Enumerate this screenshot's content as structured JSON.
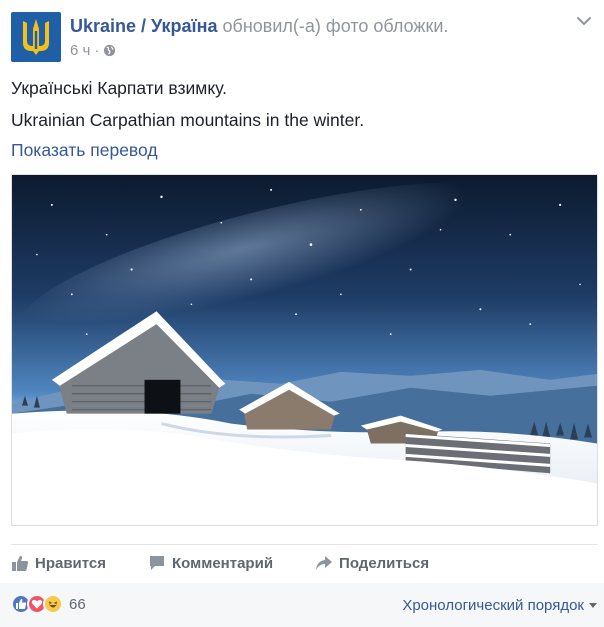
{
  "post": {
    "page_name": "Ukraine / Україна",
    "action_text": "обновил(-а) фото обложки.",
    "time": "6 ч",
    "separator": "·",
    "text_uk": "Українські Карпати взимку.",
    "text_en": "Ukrainian Carpathian mountains in the winter.",
    "translate_link": "Показать перевод"
  },
  "actions": {
    "like_label": "Нравится",
    "comment_label": "Комментарий",
    "share_label": "Поделиться"
  },
  "reactions": {
    "count": "66",
    "sort_label": "Хронологический порядок",
    "types": [
      "like",
      "love",
      "haha"
    ]
  },
  "colors": {
    "link": "#365899",
    "avatar_bg": "#1f5fa8",
    "trident": "#f2c11c",
    "like": "#4f77c6",
    "love": "#f25268",
    "haha": "#f7c94b"
  },
  "icons": {
    "avatar": "trident-coat-of-arms-icon",
    "privacy": "globe-icon",
    "menu": "chevron-down-icon",
    "like": "thumbs-up-icon",
    "comment": "speech-bubble-icon",
    "share": "share-arrow-icon"
  }
}
